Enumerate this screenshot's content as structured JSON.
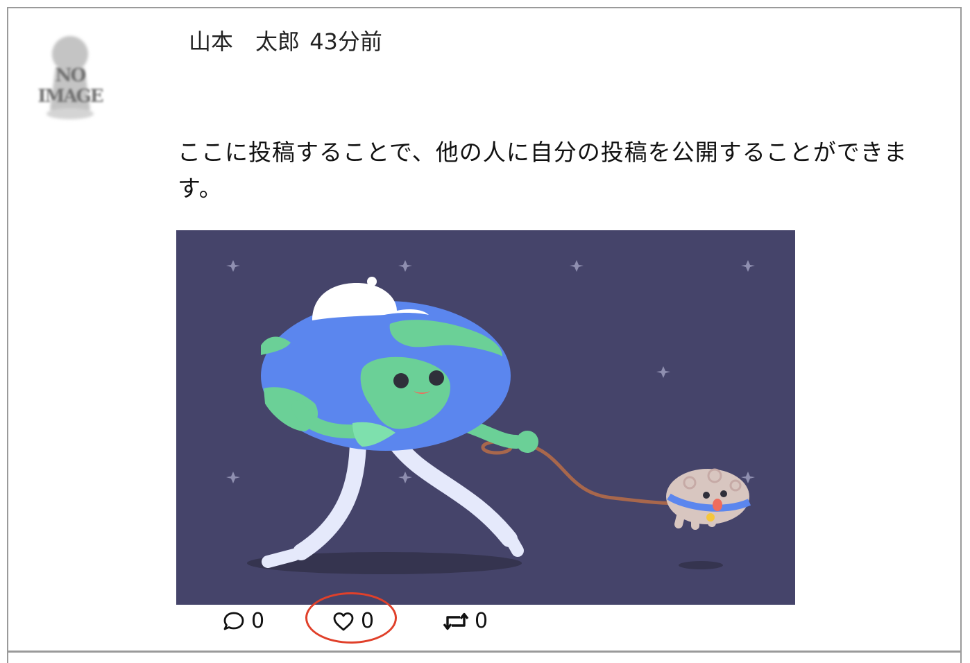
{
  "post": {
    "author_name": "山本　太郎",
    "posted_ago": "43分前",
    "body": "ここに投稿することで、他の人に自分の投稿を公開することができます。",
    "avatar_placeholder": "NO IMAGE"
  },
  "actions": {
    "comment_count": "0",
    "like_count": "0",
    "retweet_count": "0"
  },
  "icons": {
    "comment": "speech-bubble-icon",
    "like": "heart-icon",
    "retweet": "retweet-icon"
  },
  "colors": {
    "image_background": "#45446a",
    "highlight": "#e0402a",
    "border": "#9a9a9a"
  }
}
